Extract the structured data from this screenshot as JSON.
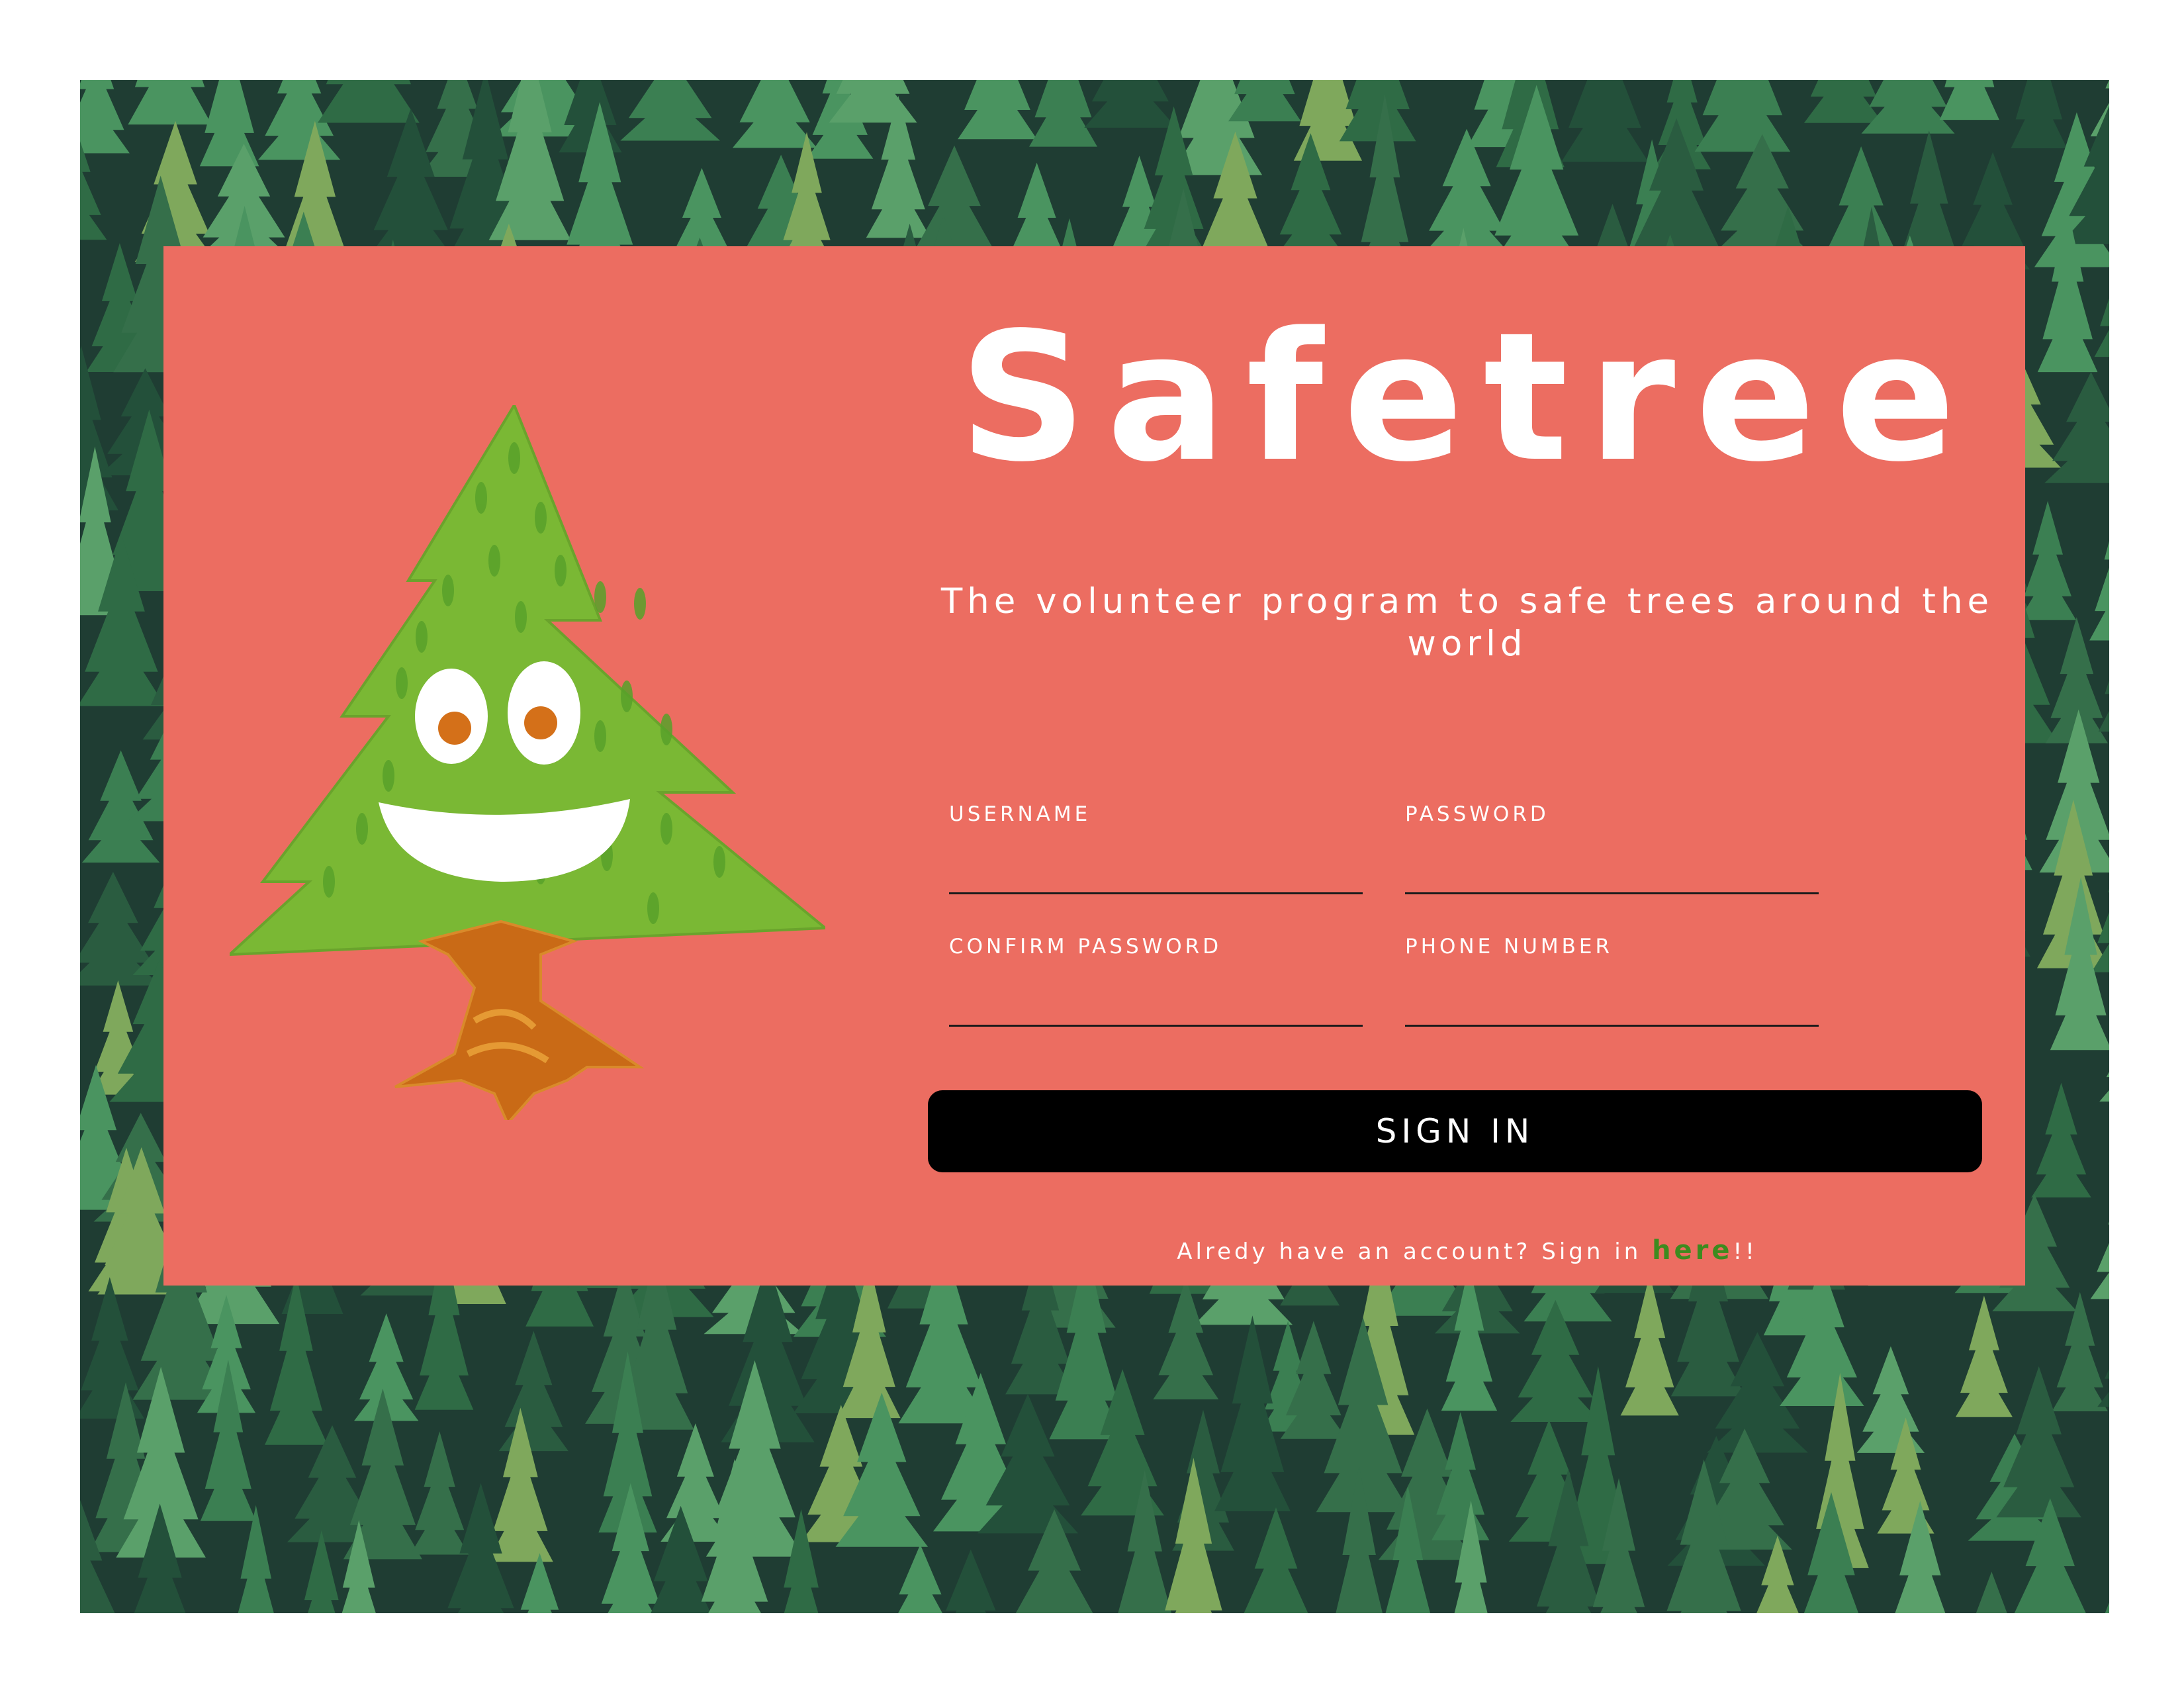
{
  "app": {
    "title": "Safetree",
    "tagline": "The volunteer program to safe trees around the world"
  },
  "form": {
    "fields": [
      {
        "label": "USERNAME",
        "value": ""
      },
      {
        "label": "PASSWORD",
        "value": ""
      },
      {
        "label": "CONFIRM PASSWORD",
        "value": ""
      },
      {
        "label": "PHONE NUMBER",
        "value": ""
      }
    ],
    "submit_label": "SIGN IN"
  },
  "footer": {
    "prefix": "Alredy have an account? Sign in ",
    "link_label": "here",
    "suffix": "!!"
  },
  "colors": {
    "card": "#ec6d61",
    "forest_dark": "#1f3d33",
    "button": "#000000",
    "link": "#3d8b1f",
    "text": "#ffffff"
  },
  "icons": {
    "mascot": "smiling-pine-tree"
  }
}
